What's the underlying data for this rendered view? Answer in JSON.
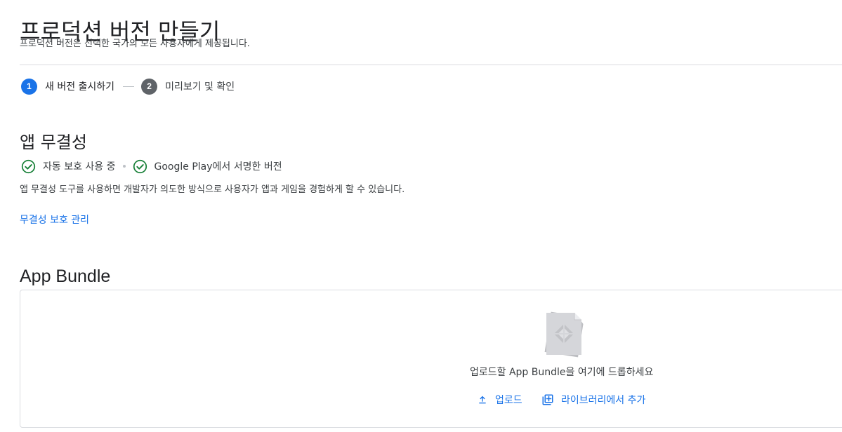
{
  "header": {
    "title": "프로덕션 버전 만들기",
    "subtitle": "프로덕션 버전은 선택한 국가의 모든 사용자에게 제공됩니다."
  },
  "stepper": {
    "steps": [
      {
        "number": "1",
        "label": "새 버전 출시하기",
        "state": "active"
      },
      {
        "number": "2",
        "label": "미리보기 및 확인",
        "state": "inactive"
      }
    ]
  },
  "integrity": {
    "title": "앱 무결성",
    "statuses": [
      {
        "icon": "check-circle-icon",
        "label": "자동 보호 사용 중"
      },
      {
        "icon": "check-circle-icon",
        "label": "Google Play에서 서명한 버전"
      }
    ],
    "description": "앱 무결성 도구를 사용하면 개발자가 의도한 방식으로 사용자가 앱과 게임을 경험하게 할 수 있습니다.",
    "manage_link": "무결성 보호 관리"
  },
  "bundle": {
    "title": "App Bundle",
    "drop_text": "업로드할 App Bundle을 여기에 드롭하세요",
    "upload_label": "업로드",
    "library_label": "라이브러리에서 추가"
  },
  "colors": {
    "accent": "#1a73e8",
    "success": "#188038",
    "inactive_step": "#5f6368"
  }
}
